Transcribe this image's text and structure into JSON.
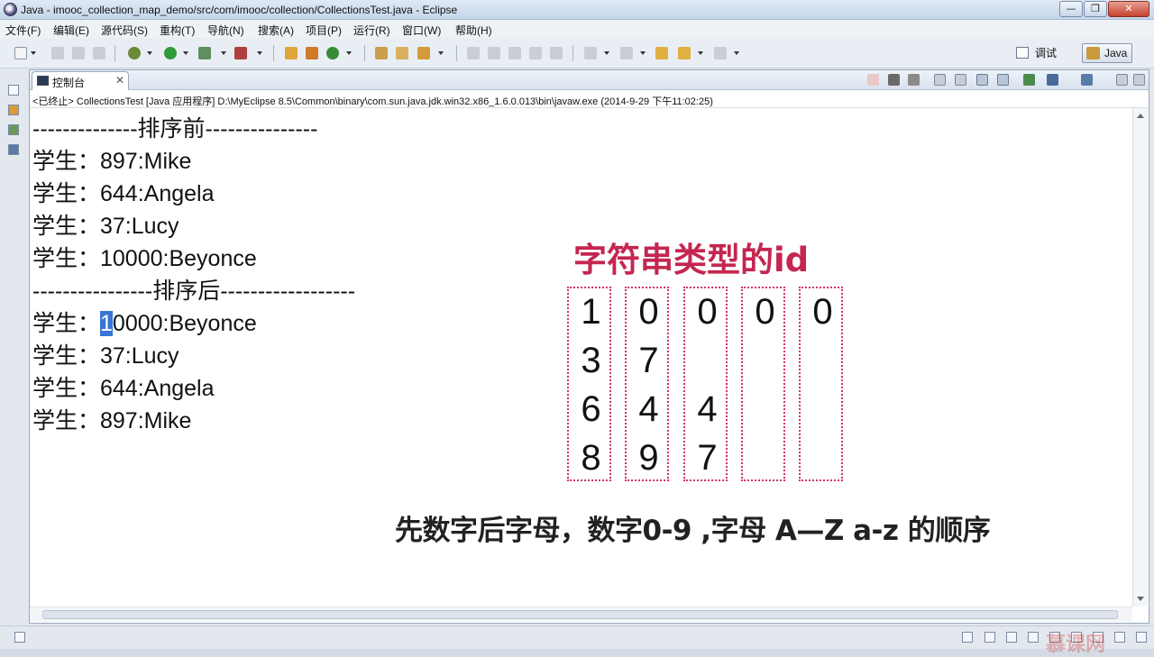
{
  "window": {
    "title": "Java - imooc_collection_map_demo/src/com/imooc/collection/CollectionsTest.java - Eclipse",
    "minimize_label": "—",
    "maximize_label": "❐",
    "close_label": "✕"
  },
  "menu": [
    "文件(F)",
    "编辑(E)",
    "源代码(S)",
    "重构(T)",
    "导航(N)",
    "搜索(A)",
    "项目(P)",
    "运行(R)",
    "窗口(W)",
    "帮助(H)"
  ],
  "perspectives": {
    "debug_label": "调试",
    "java_label": "Java"
  },
  "console": {
    "tab_label": "控制台",
    "tab_close": "✕",
    "status": "<已终止> CollectionsTest [Java 应用程序] D:\\MyEclipse 8.5\\Common\\binary\\com.sun.java.jdk.win32.x86_1.6.0.013\\bin\\javaw.exe (2014-9-29 下午11:02:25)",
    "lines": [
      "--------------排序前---------------",
      "学生：897:Mike",
      "学生：644:Angela",
      "学生：37:Lucy",
      "学生：10000:Beyonce",
      "----------------排序后------------------",
      "学生：",
      "学生：37:Lucy",
      "学生：644:Angela",
      "学生：897:Mike"
    ],
    "selected_line": {
      "prefix": "学生：",
      "selected": "1",
      "rest": "0000:Beyonce"
    }
  },
  "overlay": {
    "title": "字符串类型的id",
    "columns": [
      [
        "1",
        "3",
        "6",
        "8"
      ],
      [
        "0",
        "7",
        "4",
        "9"
      ],
      [
        "0",
        "",
        "4",
        "7"
      ],
      [
        "0",
        "",
        "",
        ""
      ],
      [
        "0",
        "",
        "",
        ""
      ]
    ],
    "caption": "先数字后字母，数字0-9 ,字母 A—Z a-z 的顺序"
  },
  "watermark": "慕课网",
  "colors": {
    "accent": "#c4264f",
    "selection": "#3875d7"
  }
}
